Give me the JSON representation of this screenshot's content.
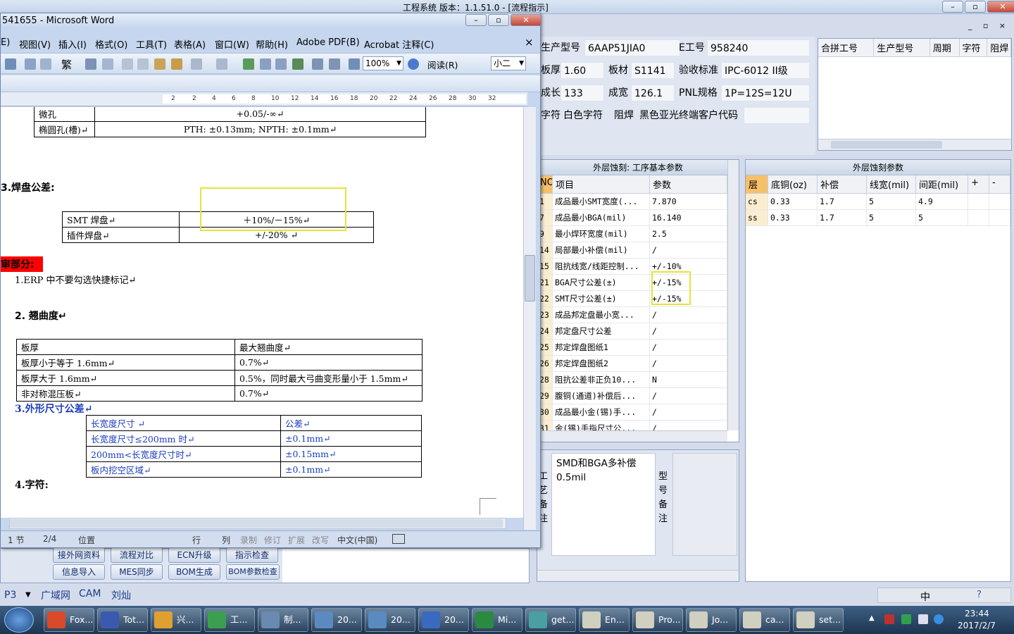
{
  "bg_app": {
    "title": "工程系统   版本：1.1.51.0 - [流程指示]",
    "controls": "_ ▫ ×",
    "sub_controls": "_ ▫ ×",
    "fields": {
      "prod_model_label": "生产型号",
      "prod_model": "6AAP51JIA0",
      "e_job_label": "E工号",
      "e_job": "958240",
      "thickness_label": "板厚",
      "thickness": "1.60",
      "material_label": "板材",
      "material": "S1141",
      "standard_label": "验收标准",
      "standard": "IPC-6012 II级",
      "length_label": "成长",
      "length": "133",
      "width_label": "成宽",
      "width": "126.1",
      "pnl_label": "PNL规格",
      "pnl": "1P=12S=12U",
      "char_label": "字符",
      "char": "白色字符",
      "mask_label": "阻焊",
      "mask": "黑色亚光",
      "client_label": "终端客户代码",
      "client": ""
    },
    "merge_grid_headers": [
      "合拼工号",
      "生产型号",
      "周期",
      "字符",
      "阻焊"
    ],
    "basic_params": {
      "title": "外层蚀刻: 工序基本参数",
      "headers": [
        "NO",
        "项目",
        "参数"
      ],
      "rows": [
        {
          "no": "1",
          "item": "成品最小SMT宽度(...",
          "val": "7.870"
        },
        {
          "no": "7",
          "item": "成品最小BGA(mil)",
          "val": "16.140"
        },
        {
          "no": "9",
          "item": "最小焊环宽度(mil)",
          "val": "2.5"
        },
        {
          "no": "14",
          "item": "局部最小补偿(mil)",
          "val": "/"
        },
        {
          "no": "15",
          "item": "阻抗线宽/线距控制...",
          "val": "+/-10%"
        },
        {
          "no": "21",
          "item": "BGA尺寸公差(±)",
          "val": "+/-15%"
        },
        {
          "no": "22",
          "item": "SMT尺寸公差(±)",
          "val": "+/-15%"
        },
        {
          "no": "23",
          "item": "成品邦定盘最小宽...",
          "val": "/"
        },
        {
          "no": "24",
          "item": "邦定盘尺寸公差",
          "val": "/"
        },
        {
          "no": "25",
          "item": "邦定焊盘图纸1",
          "val": "/"
        },
        {
          "no": "26",
          "item": "邦定焊盘图纸2",
          "val": "/"
        },
        {
          "no": "28",
          "item": "阻抗公差非正负10...",
          "val": "N"
        },
        {
          "no": "29",
          "item": "腹铜(通道)补偿后...",
          "val": "/"
        },
        {
          "no": "30",
          "item": "成品最小金(锡)手...",
          "val": "/"
        },
        {
          "no": "31",
          "item": "金(锡)手指尺寸公...",
          "val": "/"
        }
      ]
    },
    "etch_params": {
      "title": "外层蚀刻参数",
      "headers": [
        "层",
        "底铜(oz)",
        "补偿",
        "线宽(mil)",
        "间距(mil)",
        "+",
        "-"
      ],
      "rows": [
        {
          "layer": "cs",
          "base": "0.33",
          "comp": "1.7",
          "lw": "5",
          "sp": "4.9"
        },
        {
          "layer": "ss",
          "base": "0.33",
          "comp": "1.7",
          "lw": "5",
          "sp": "5"
        }
      ]
    },
    "process_note_label": "工艺备注",
    "process_note": "SMD和BGA多补偿0.5mil",
    "model_note_label": "型号备注",
    "buttons": [
      "接外网资料",
      "流程对比",
      "ECN升级",
      "指示检查",
      "信息导入",
      "MES同步",
      "BOM生成",
      "BOM参数检查"
    ],
    "bottom_tabs": [
      "P3",
      "广域网",
      "CAM",
      "刘灿"
    ]
  },
  "word": {
    "title": "541655 - Microsoft Word",
    "menu": [
      "E)",
      "视图(V)",
      "插入(I)",
      "格式(O)",
      "工具(T)",
      "表格(A)",
      "窗口(W)",
      "帮助(H)",
      "Adobe PDF(B)",
      "Acrobat 注释(C)"
    ],
    "close": "×",
    "zoom": "100%",
    "font_size": "小二",
    "read_label": "阅读(R)",
    "trad_label": "繁",
    "ruler_nums": [
      "2",
      "2",
      "4",
      "6",
      "8",
      "10",
      "12",
      "14",
      "16",
      "18",
      "20",
      "22",
      "24",
      "26",
      "28",
      "30",
      "32"
    ],
    "doc": {
      "tol_rows": [
        [
          "微孔",
          "+0.05/-∞↵"
        ],
        [
          "椭圆孔(槽)↵",
          "PTH: ±0.13mm; NPTH: ±0.1mm↵"
        ]
      ],
      "pad_heading": "3.焊盘公差:",
      "pad_rows": [
        [
          "SMT 焊盘↵",
          "＋10%/－15%↵"
        ],
        [
          "插件焊盘↵",
          "+/-20% ↵"
        ]
      ],
      "review_heading": "审部分:",
      "review_item": "1.ERP 中不要勾选快捷标记↵",
      "warp_heading": "2.  翘曲度↵",
      "warp_rows": [
        [
          "板厚",
          "最大翘曲度↵"
        ],
        [
          "板厚小于等于 1.6mm↵",
          "0.7%↵"
        ],
        [
          "板厚大于 1.6mm↵",
          "0.5%，同时最大弓曲变形量小于 1.5mm↵"
        ],
        [
          "非对称混压板↵",
          "0.7%↵"
        ]
      ],
      "outline_heading": "3.外形尺寸公差↵",
      "outline_rows": [
        [
          "长宽度尺寸  ↵",
          "公差↵"
        ],
        [
          "长宽度尺寸≤200mm 时↵",
          "±0.1mm↵"
        ],
        [
          "200mm<长宽度尺寸时↵",
          "±0.15mm↵"
        ],
        [
          "板内挖空区域↵",
          "±0.1mm↵"
        ]
      ],
      "char_heading": "4.字符: "
    },
    "status": [
      "1 节",
      "2/4",
      "位置",
      "行",
      "列",
      "录制",
      "修订",
      "扩展",
      "改写",
      "中文(中国)"
    ]
  },
  "taskbar": {
    "items": [
      "Fox...",
      "Tot...",
      "兴...",
      "工...",
      "制...",
      "20...",
      "20...",
      "20...",
      "Mi...",
      "get...",
      "En...",
      "Pro...",
      "Jo...",
      "ca...",
      "set..."
    ],
    "time": "23:44",
    "date": "2017/2/7",
    "ime": "中"
  }
}
